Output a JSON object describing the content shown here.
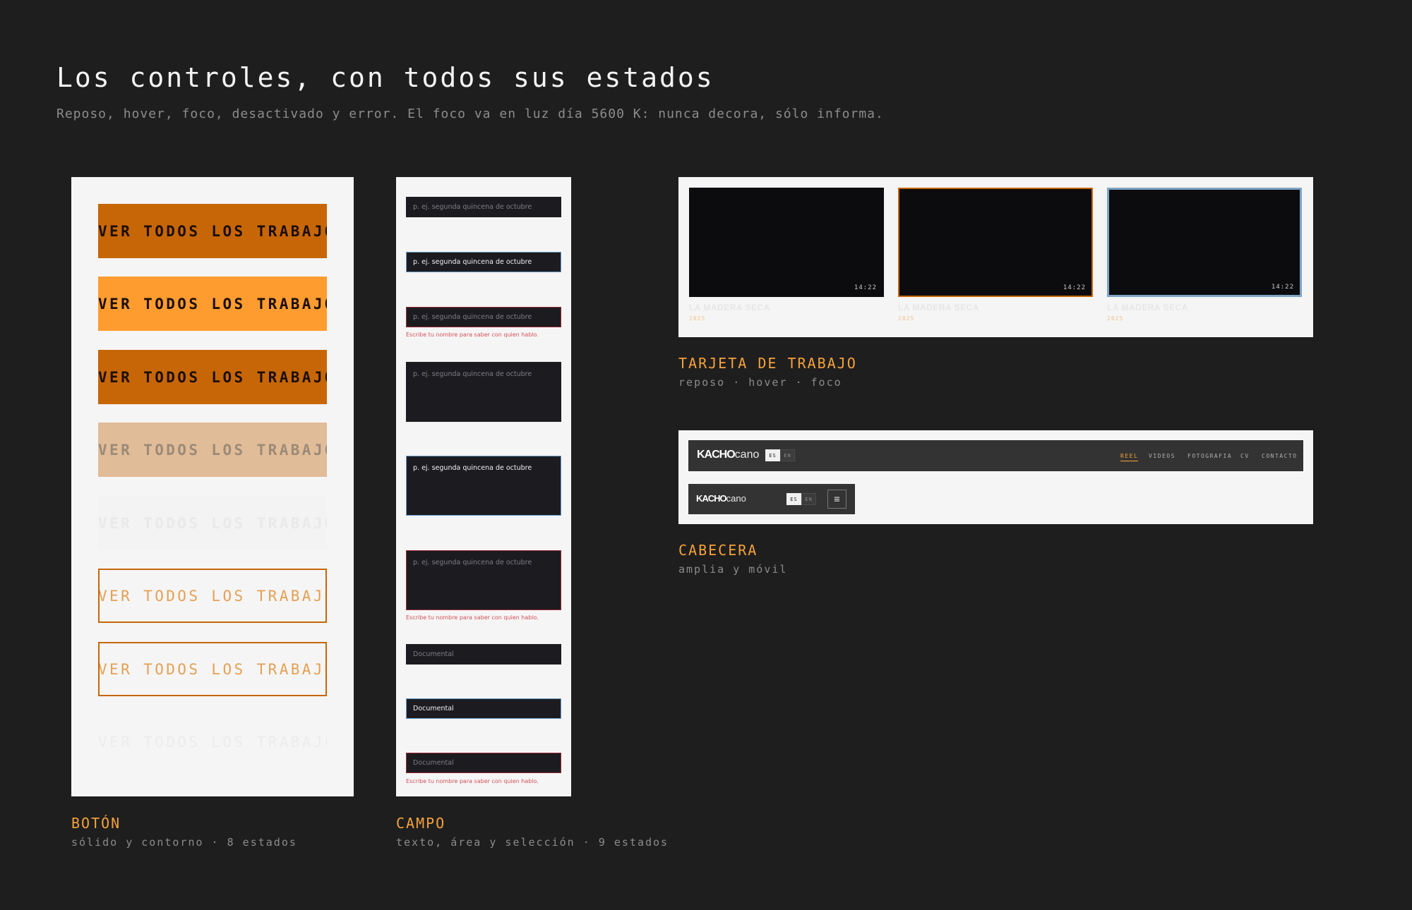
{
  "page": {
    "title": "Los controles, con todos sus estados",
    "subtitle": "Reposo, hover, foco, desactivado y error. El foco va en luz día 5600 K: nunca decora, sólo informa."
  },
  "buttons": {
    "label": "VER TODOS LOS TRABAJOS",
    "caption_title": "BOTÓN",
    "caption_sub": "sólido y contorno · 8 estados"
  },
  "fields": {
    "placeholder": "p. ej. segunda quincena de octubre",
    "select_value": "Documental",
    "error_message": "Escribe tu nombre para saber con quien hablo.",
    "caption_title": "CAMPO",
    "caption_sub": "texto, área y selección · 9 estados"
  },
  "cards": {
    "duration": "14:22",
    "title": "LA MADERA SECA",
    "year": "2025",
    "caption_title": "TARJETA DE TRABAJO",
    "caption_sub": "reposo · hover · foco"
  },
  "header": {
    "logo_bold": "KACHO",
    "logo_light": "cano",
    "lang_es": "ES",
    "lang_en": "EN",
    "nav": [
      "REEL",
      "VIDEOS",
      "FOTOGRAFIA",
      "CV",
      "CONTACTO"
    ],
    "menu_icon": "≡",
    "caption_title": "CABECERA",
    "caption_sub": "amplia y móvil"
  },
  "colors": {
    "accent": "#f5a23a",
    "button_solid": "#c76607",
    "button_hover": "#ff9c30",
    "focus": "#7fa4c6",
    "error": "#d4505a",
    "background": "#1e1e1e"
  }
}
